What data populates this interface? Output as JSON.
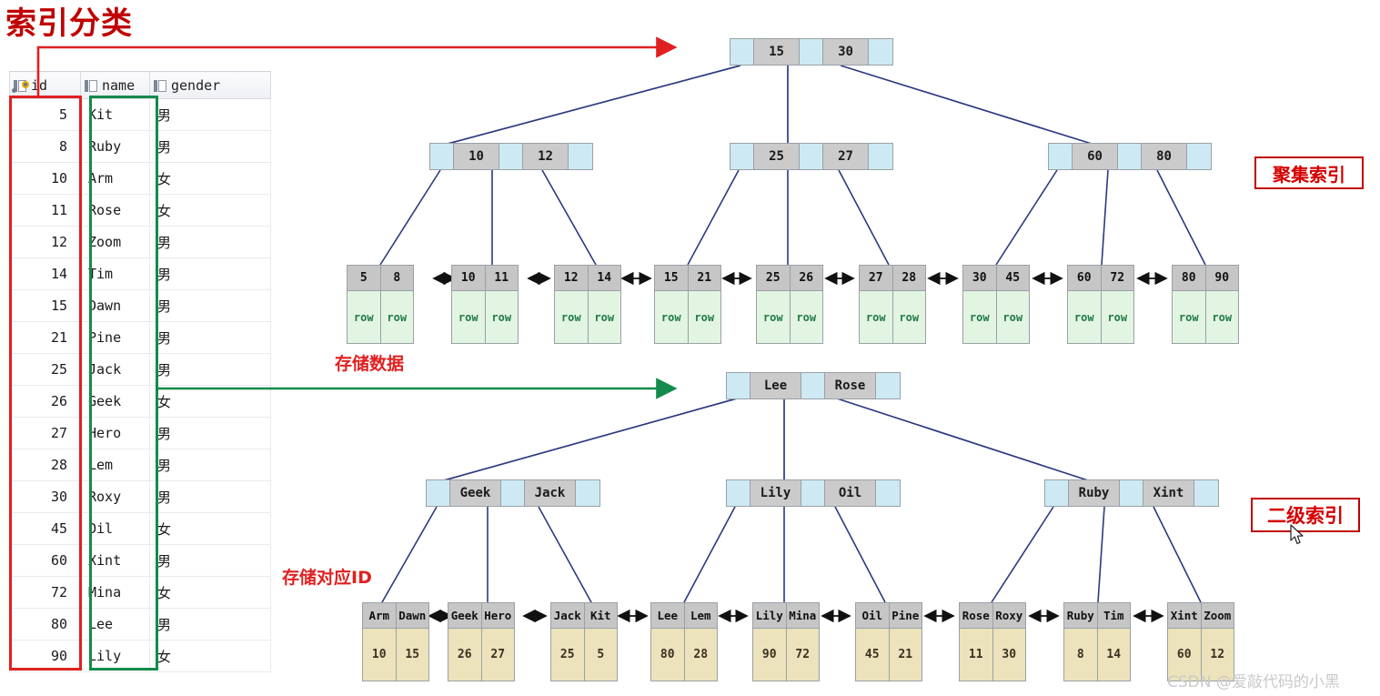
{
  "title": "索引分类",
  "table": {
    "columns": [
      {
        "key": "id",
        "label": "id",
        "icon": "primary-key-column-icon"
      },
      {
        "key": "name",
        "label": "name",
        "icon": "column-icon"
      },
      {
        "key": "gender",
        "label": "gender",
        "icon": "column-icon"
      }
    ],
    "rows": [
      {
        "id": "5",
        "name": "Kit",
        "gender": "男"
      },
      {
        "id": "8",
        "name": "Ruby",
        "gender": "男"
      },
      {
        "id": "10",
        "name": "Arm",
        "gender": "女"
      },
      {
        "id": "11",
        "name": "Rose",
        "gender": "女"
      },
      {
        "id": "12",
        "name": "Zoom",
        "gender": "男"
      },
      {
        "id": "14",
        "name": "Tim",
        "gender": "男"
      },
      {
        "id": "15",
        "name": "Dawn",
        "gender": "男"
      },
      {
        "id": "21",
        "name": "Pine",
        "gender": "男"
      },
      {
        "id": "25",
        "name": "Jack",
        "gender": "男"
      },
      {
        "id": "26",
        "name": "Geek",
        "gender": "女"
      },
      {
        "id": "27",
        "name": "Hero",
        "gender": "男"
      },
      {
        "id": "28",
        "name": "Lem",
        "gender": "男"
      },
      {
        "id": "30",
        "name": "Roxy",
        "gender": "男"
      },
      {
        "id": "45",
        "name": "Oil",
        "gender": "女"
      },
      {
        "id": "60",
        "name": "Xint",
        "gender": "男"
      },
      {
        "id": "72",
        "name": "Mina",
        "gender": "女"
      },
      {
        "id": "80",
        "name": "Lee",
        "gender": "男"
      },
      {
        "id": "90",
        "name": "Lily",
        "gender": "女"
      }
    ]
  },
  "clustered_index": {
    "root": {
      "keys": [
        "15",
        "30"
      ]
    },
    "internal": [
      {
        "keys": [
          "10",
          "12"
        ]
      },
      {
        "keys": [
          "25",
          "27"
        ]
      },
      {
        "keys": [
          "60",
          "80"
        ]
      }
    ],
    "leaves": [
      {
        "keys": [
          "5",
          "8"
        ],
        "values": [
          "row",
          "row"
        ]
      },
      {
        "keys": [
          "10",
          "11"
        ],
        "values": [
          "row",
          "row"
        ]
      },
      {
        "keys": [
          "12",
          "14"
        ],
        "values": [
          "row",
          "row"
        ]
      },
      {
        "keys": [
          "15",
          "21"
        ],
        "values": [
          "row",
          "row"
        ]
      },
      {
        "keys": [
          "25",
          "26"
        ],
        "values": [
          "row",
          "row"
        ]
      },
      {
        "keys": [
          "27",
          "28"
        ],
        "values": [
          "row",
          "row"
        ]
      },
      {
        "keys": [
          "30",
          "45"
        ],
        "values": [
          "row",
          "row"
        ]
      },
      {
        "keys": [
          "60",
          "72"
        ],
        "values": [
          "row",
          "row"
        ]
      },
      {
        "keys": [
          "80",
          "90"
        ],
        "values": [
          "row",
          "row"
        ]
      }
    ]
  },
  "secondary_index": {
    "root": {
      "keys": [
        "Lee",
        "Rose"
      ]
    },
    "internal": [
      {
        "keys": [
          "Geek",
          "Jack"
        ]
      },
      {
        "keys": [
          "Lily",
          "Oil"
        ]
      },
      {
        "keys": [
          "Ruby",
          "Xint"
        ]
      }
    ],
    "leaves": [
      {
        "keys": [
          "Arm",
          "Dawn"
        ],
        "values": [
          "10",
          "15"
        ]
      },
      {
        "keys": [
          "Geek",
          "Hero"
        ],
        "values": [
          "26",
          "27"
        ]
      },
      {
        "keys": [
          "Jack",
          "Kit"
        ],
        "values": [
          "25",
          "5"
        ]
      },
      {
        "keys": [
          "Lee",
          "Lem"
        ],
        "values": [
          "80",
          "28"
        ]
      },
      {
        "keys": [
          "Lily",
          "Mina"
        ],
        "values": [
          "90",
          "72"
        ]
      },
      {
        "keys": [
          "Oil",
          "Pine"
        ],
        "values": [
          "45",
          "21"
        ]
      },
      {
        "keys": [
          "Rose",
          "Roxy"
        ],
        "values": [
          "11",
          "30"
        ]
      },
      {
        "keys": [
          "Ruby",
          "Tim"
        ],
        "values": [
          "8",
          "14"
        ]
      },
      {
        "keys": [
          "Xint",
          "Zoom"
        ],
        "values": [
          "60",
          "12"
        ]
      }
    ]
  },
  "annotations": {
    "clustered_label": "聚集索引",
    "secondary_label": "二级索引",
    "store_data": "存储数据",
    "store_id": "存储对应ID"
  },
  "watermark": "CSDN @爱敲代码的小黑",
  "colors": {
    "title_red": "#c00000",
    "highlight_red": "#e02020",
    "highlight_green": "#128b4b",
    "pointer_blue": "#cdeaf4",
    "key_gray": "#cbcbcb",
    "row_green": "#e2f4e2",
    "id_tan": "#ece3bc",
    "connector_navy": "#2b3a80"
  }
}
